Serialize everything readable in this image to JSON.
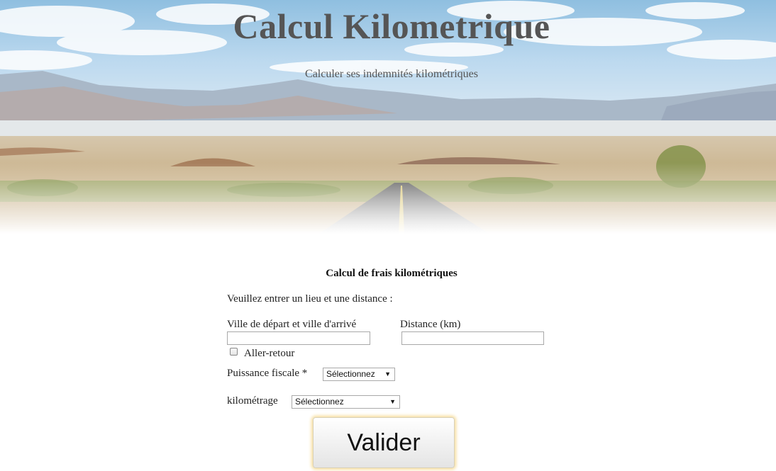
{
  "header": {
    "title": "Calcul Kilometrique",
    "subtitle": "Calculer ses indemnités kilométriques"
  },
  "form": {
    "heading": "Calcul de frais kilométriques",
    "instructions": "Veuillez entrer un lieu et une distance :",
    "cities": {
      "label": "Ville de départ et ville d'arrivé",
      "value": ""
    },
    "distance": {
      "label": "Distance (km)",
      "value": ""
    },
    "round_trip": {
      "label": "Aller-retour",
      "checked": false
    },
    "fiscal_power": {
      "label": "Puissance fiscale *",
      "selected": "Sélectionnez"
    },
    "mileage": {
      "label": "kilométrage",
      "selected": "Sélectionnez"
    },
    "submit_label": "Valider"
  }
}
